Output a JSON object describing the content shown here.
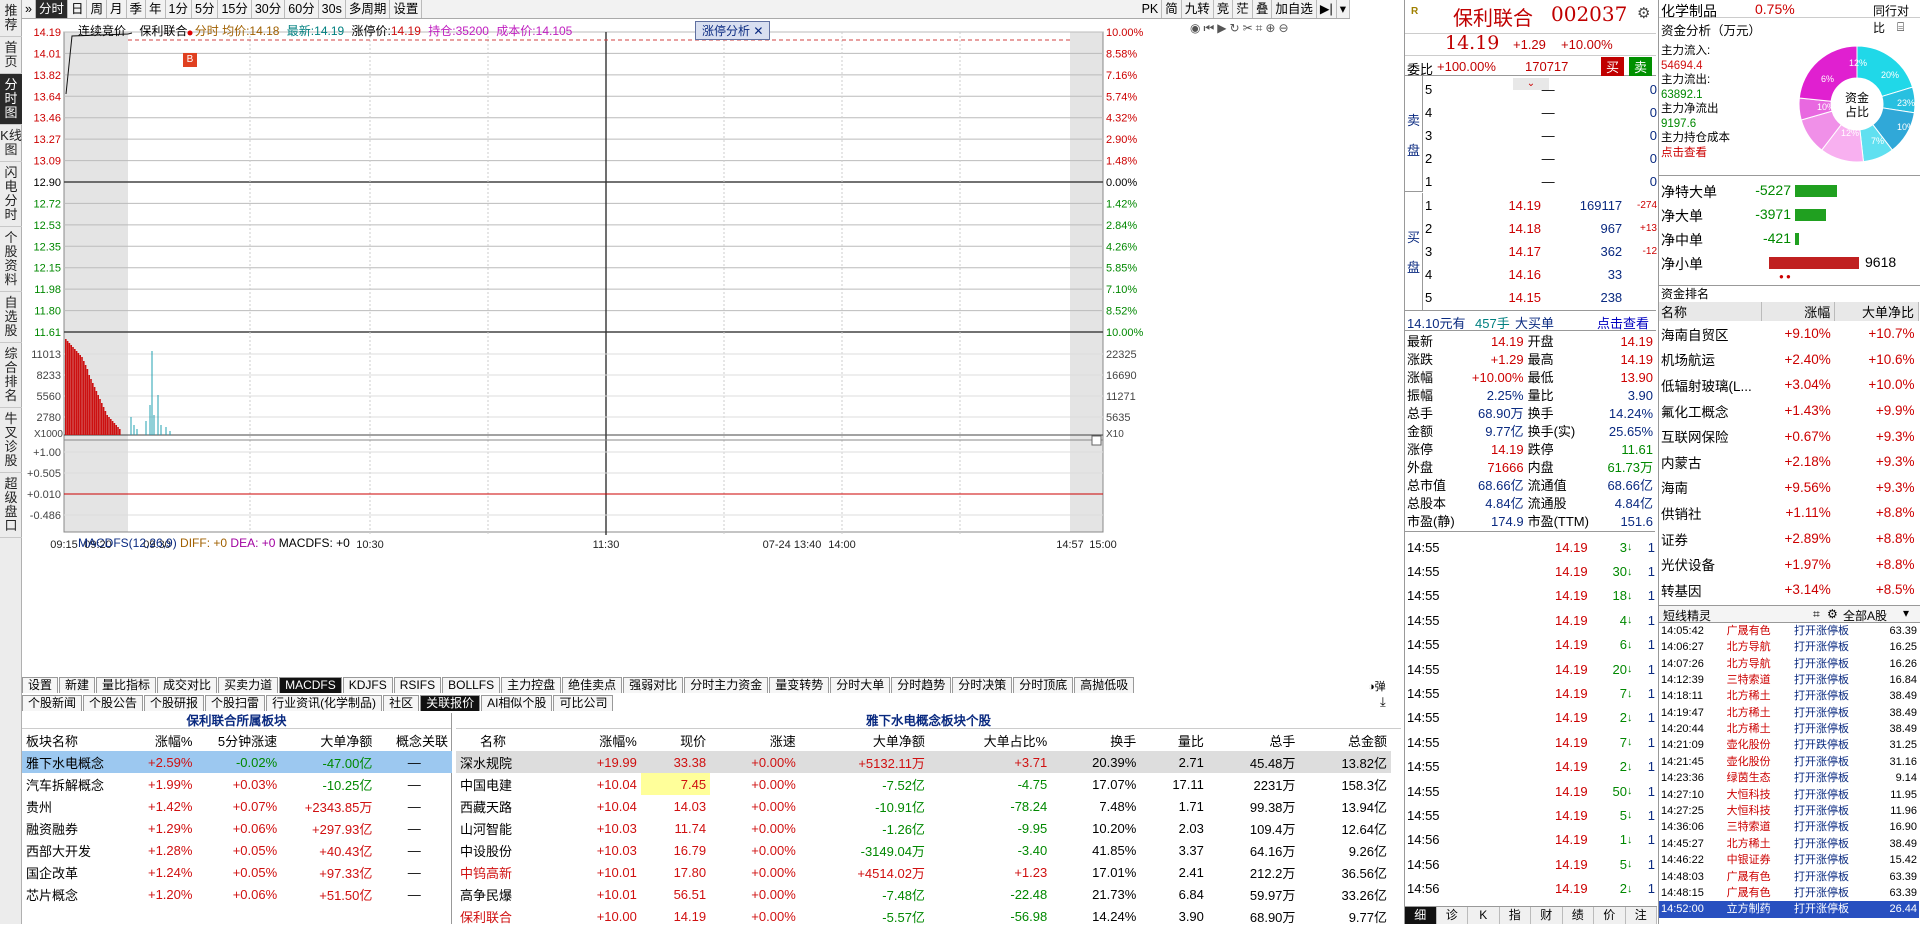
{
  "leftnav": [
    "推荐",
    "首页",
    "分时图",
    "K线图",
    "闪电分时",
    "个股资料",
    "自选股",
    "综合排名",
    "牛叉诊股",
    "超级盘口"
  ],
  "leftnav_active": 2,
  "toolbar": {
    "items": [
      "分时",
      "日",
      "周",
      "月",
      "季",
      "年",
      "1分",
      "5分",
      "15分",
      "30分",
      "60分",
      "30s",
      "多周期",
      "设置"
    ],
    "active": 0,
    "right_items": [
      "PK",
      "简",
      "九转",
      "竞",
      "茫",
      "叠",
      "加自选"
    ]
  },
  "chart_header": {
    "mode": "连续竞价",
    "name": "保利联合",
    "tick_label": "分时",
    "avg_label": "均价:",
    "avg_val": "14.18",
    "latest_label": "最新:",
    "latest_val": "14.19",
    "limit_label": "涨停价:",
    "limit_val": "14.19",
    "pos_label": "持仓:",
    "pos_val": "35200",
    "cost_label": "成本价:",
    "cost_val": "14.105",
    "zt_tab": "涨停分析",
    "b_marker": "B"
  },
  "price_axis_left": [
    "14.19",
    "14.01",
    "13.82",
    "13.64",
    "13.46",
    "13.27",
    "13.09",
    "12.90",
    "12.72",
    "12.53",
    "12.35",
    "12.15",
    "11.98",
    "11.80",
    "11.61"
  ],
  "price_axis_right": [
    "10.00%",
    "8.58%",
    "7.16%",
    "5.74%",
    "4.32%",
    "2.90%",
    "1.48%",
    "0.00%",
    "1.42%",
    "2.84%",
    "4.26%",
    "5.85%",
    "7.10%",
    "8.52%",
    "10.00%"
  ],
  "vol_axis_left": [
    "11013",
    "8233",
    "5560",
    "2780"
  ],
  "vol_axis_right": [
    "22325",
    "16690",
    "11271",
    "5635"
  ],
  "vol_unit": "X1000",
  "vol_unit_r": "X10",
  "macd_label": {
    "name": "MACDFS(12,26,9)",
    "diff": "DIFF: +0",
    "dea": "DEA: +0",
    "macdfs": "MACDFS: +0"
  },
  "macd_axis": [
    "+1.00",
    "+0.505",
    "+0.010",
    "-0.486"
  ],
  "time_axis": [
    "09:15",
    "09:20",
    "09:30",
    "10:30",
    "11:30",
    "07-24 13:40",
    "14:00",
    "14:57",
    "15:00"
  ],
  "ind_tabs": [
    "设置",
    "新建",
    "量比指标",
    "成交对比",
    "买卖力道",
    "MACDFS",
    "KDJFS",
    "RSIFS",
    "BOLLFS",
    "主力控盘",
    "绝佳卖点",
    "强弱对比",
    "分时主力资金",
    "量变转势",
    "分时大单",
    "分时趋势",
    "分时决策",
    "分时顶底",
    "高抛低吸"
  ],
  "ind_active": 5,
  "ind_right": "弹",
  "sub_tabs": [
    "个股新闻",
    "个股公告",
    "个股研报",
    "个股扫雷",
    "行业资讯(化学制品)",
    "社区",
    "关联报价",
    "AI相似个股",
    "可比公司"
  ],
  "sub_active": 6,
  "sector_table": {
    "title": "保利联合所属板块",
    "headers": [
      "板块名称",
      "涨幅%",
      "5分钟涨速",
      "大单净额",
      "概念关联"
    ],
    "rows": [
      [
        "雅下水电概念",
        "+2.59%",
        "-0.02%",
        "-47.00亿",
        "—"
      ],
      [
        "汽车拆解概念",
        "+1.99%",
        "+0.03%",
        "-10.25亿",
        "—"
      ],
      [
        "贵州",
        "+1.42%",
        "+0.07%",
        "+2343.85万",
        "—"
      ],
      [
        "融资融券",
        "+1.29%",
        "+0.06%",
        "+297.93亿",
        "—"
      ],
      [
        "西部大开发",
        "+1.28%",
        "+0.05%",
        "+40.43亿",
        "—"
      ],
      [
        "国企改革",
        "+1.24%",
        "+0.05%",
        "+97.33亿",
        "—"
      ],
      [
        "芯片概念",
        "+1.20%",
        "+0.06%",
        "+51.50亿",
        "—"
      ]
    ]
  },
  "stock_table": {
    "title": "雅下水电概念板块个股",
    "headers": [
      "名称",
      "涨幅%",
      "现价",
      "涨速",
      "大单净额",
      "大单占比%",
      "换手",
      "量比",
      "总手",
      "总金额"
    ],
    "rows": [
      [
        "深水规院",
        "+19.99",
        "33.38",
        "+0.00%",
        "+5132.11万",
        "+3.71",
        "20.39%",
        "2.71",
        "45.48万",
        "13.82亿"
      ],
      [
        "中国电建",
        "+10.04",
        "7.45",
        "+0.00%",
        "-7.52亿",
        "-4.75",
        "17.07%",
        "17.11",
        "2231万",
        "158.3亿"
      ],
      [
        "西藏天路",
        "+10.04",
        "14.03",
        "+0.00%",
        "-10.91亿",
        "-78.24",
        "7.48%",
        "1.71",
        "99.38万",
        "13.94亿"
      ],
      [
        "山河智能",
        "+10.03",
        "11.74",
        "+0.00%",
        "-1.26亿",
        "-9.95",
        "10.20%",
        "2.03",
        "109.4万",
        "12.64亿"
      ],
      [
        "中设股份",
        "+10.03",
        "16.79",
        "+0.00%",
        "-3149.04万",
        "-3.40",
        "41.85%",
        "3.37",
        "64.16万",
        "9.26亿"
      ],
      [
        "中钨高新",
        "+10.01",
        "17.80",
        "+0.00%",
        "+4514.02万",
        "+1.23",
        "17.01%",
        "2.41",
        "212.2万",
        "36.56亿"
      ],
      [
        "高争民爆",
        "+10.01",
        "56.51",
        "+0.00%",
        "-7.48亿",
        "-22.48",
        "21.73%",
        "6.84",
        "59.97万",
        "33.26亿"
      ],
      [
        "保利联合",
        "+10.00",
        "14.19",
        "+0.00%",
        "-5.57亿",
        "-56.98",
        "14.24%",
        "3.90",
        "68.90万",
        "9.77亿"
      ]
    ]
  },
  "stock": {
    "badge": "R",
    "name": "保利联合",
    "code": "002037",
    "price": "14.19",
    "chg": "+1.29",
    "pct": "+10.00%",
    "ratio_label": "委比",
    "ratio": "+100.00%",
    "ratio_diff": "170717",
    "buy": "买",
    "sell": "卖"
  },
  "orderbook": {
    "sell_label": [
      "卖",
      "盘"
    ],
    "buy_label": [
      "买",
      "盘"
    ],
    "sell": [
      [
        "5",
        "—",
        "0"
      ],
      [
        "4",
        "—",
        "0"
      ],
      [
        "3",
        "—",
        "0"
      ],
      [
        "2",
        "—",
        "0"
      ],
      [
        "1",
        "—",
        "0"
      ]
    ],
    "buy": [
      [
        "1",
        "14.19",
        "169117",
        "-274"
      ],
      [
        "2",
        "14.18",
        "967",
        "+13"
      ],
      [
        "3",
        "14.17",
        "362",
        "-12"
      ],
      [
        "4",
        "14.16",
        "33",
        ""
      ],
      [
        "5",
        "14.15",
        "238",
        ""
      ]
    ]
  },
  "bigorder": {
    "price": "14.10元有",
    "vol": "457手",
    "kind": "大买单",
    "link": "点击查看"
  },
  "quote": [
    [
      "最新",
      "14.19",
      "开盘",
      "14.19"
    ],
    [
      "涨跌",
      "+1.29",
      "最高",
      "14.19"
    ],
    [
      "涨幅",
      "+10.00%",
      "最低",
      "13.90"
    ],
    [
      "振幅",
      "2.25%",
      "量比",
      "3.90"
    ],
    [
      "总手",
      "68.90万",
      "换手",
      "14.24%"
    ],
    [
      "金额",
      "9.77亿",
      "换手(实)",
      "25.65%"
    ],
    [
      "涨停",
      "14.19",
      "跌停",
      "11.61"
    ],
    [
      "外盘",
      "71666",
      "内盘",
      "61.73万"
    ],
    [
      "总市值",
      "68.66亿",
      "流通值",
      "68.66亿"
    ],
    [
      "总股本",
      "4.84亿",
      "流通股",
      "4.84亿"
    ],
    [
      "市盈(静)",
      "174.9",
      "市盈(TTM)",
      "151.6"
    ]
  ],
  "ticks": [
    [
      "14:55",
      "14.19",
      "3"
    ],
    [
      "14:55",
      "14.19",
      "30"
    ],
    [
      "14:55",
      "14.19",
      "18"
    ],
    [
      "14:55",
      "14.19",
      "4"
    ],
    [
      "14:55",
      "14.19",
      "6"
    ],
    [
      "14:55",
      "14.19",
      "20"
    ],
    [
      "14:55",
      "14.19",
      "7"
    ],
    [
      "14:55",
      "14.19",
      "2"
    ],
    [
      "14:55",
      "14.19",
      "7"
    ],
    [
      "14:55",
      "14.19",
      "2"
    ],
    [
      "14:55",
      "14.19",
      "50"
    ],
    [
      "14:55",
      "14.19",
      "5"
    ],
    [
      "14:56",
      "14.19",
      "1"
    ],
    [
      "14:56",
      "14.19",
      "5"
    ],
    [
      "14:56",
      "14.19",
      "2"
    ]
  ],
  "tick_counts": [
    "1",
    "1",
    "1",
    "1",
    "1",
    "1",
    "1",
    "1",
    "1",
    "1",
    "1",
    "1",
    "1",
    "1",
    "1"
  ],
  "bottom_tabs": [
    "细",
    "诊",
    "K",
    "指",
    "财",
    "绩",
    "价",
    "注"
  ],
  "industry": {
    "name": "化学制品",
    "pct": "0.75%",
    "link": "同行对比"
  },
  "capital": {
    "title": "资金分析（万元）",
    "inflow_label": "主力流入:",
    "inflow": "54694.4",
    "outflow_label": "主力流出:",
    "outflow": "63892.1",
    "net_label": "主力净流出",
    "net": "9197.6",
    "cost_label": "主力持仓成本",
    "cost_link": "点击查看",
    "pie_center": [
      "资金",
      "占比"
    ],
    "pie_labels": [
      "20%",
      "23%",
      "10%",
      "7%",
      "12%",
      "10%",
      "6%",
      "12%"
    ]
  },
  "netflows": [
    {
      "label": "净特大单",
      "value": "-5227",
      "frac": 0.54
    },
    {
      "label": "净大单",
      "value": "-3971",
      "frac": 0.41
    },
    {
      "label": "净中单",
      "value": "-421",
      "frac": 0.05
    },
    {
      "label": "净小单",
      "value": "9618",
      "frac": 1.0
    }
  ],
  "rank": {
    "title": "资金排名",
    "headers": [
      "名称",
      "涨幅",
      "大单净比"
    ],
    "rows": [
      [
        "海南自贸区",
        "+9.10%",
        "+10.7%"
      ],
      [
        "机场航运",
        "+2.40%",
        "+10.6%"
      ],
      [
        "低辐射玻璃(L...",
        "+3.04%",
        "+10.0%"
      ],
      [
        "氟化工概念",
        "+1.43%",
        "+9.9%"
      ],
      [
        "互联网保险",
        "+0.67%",
        "+9.3%"
      ],
      [
        "内蒙古",
        "+2.18%",
        "+9.3%"
      ],
      [
        "海南",
        "+9.56%",
        "+9.3%"
      ],
      [
        "供销社",
        "+1.11%",
        "+8.8%"
      ],
      [
        "证券",
        "+2.89%",
        "+8.8%"
      ],
      [
        "光伏设备",
        "+1.97%",
        "+8.8%"
      ],
      [
        "转基因",
        "+3.14%",
        "+8.5%"
      ]
    ]
  },
  "shortline": {
    "title": "短线精灵",
    "filter": "全部A股",
    "rows": [
      [
        "14:05:42",
        "广晟有色",
        "打开涨停板",
        "63.39"
      ],
      [
        "14:06:27",
        "北方导航",
        "打开涨停板",
        "16.25"
      ],
      [
        "14:07:26",
        "北方导航",
        "打开涨停板",
        "16.26"
      ],
      [
        "14:12:39",
        "三特索道",
        "打开涨停板",
        "16.84"
      ],
      [
        "14:18:11",
        "北方稀土",
        "打开涨停板",
        "38.49"
      ],
      [
        "14:19:47",
        "北方稀土",
        "打开涨停板",
        "38.49"
      ],
      [
        "14:20:44",
        "北方稀土",
        "打开涨停板",
        "38.49"
      ],
      [
        "14:21:09",
        "壶化股份",
        "打开跌停板",
        "31.25"
      ],
      [
        "14:21:45",
        "壶化股份",
        "打开涨停板",
        "31.16"
      ],
      [
        "14:23:36",
        "绿茵生态",
        "打开涨停板",
        "9.14"
      ],
      [
        "14:27:10",
        "大恒科技",
        "打开涨停板",
        "11.95"
      ],
      [
        "14:27:25",
        "大恒科技",
        "打开涨停板",
        "11.96"
      ],
      [
        "14:36:06",
        "三特索道",
        "打开涨停板",
        "16.90"
      ],
      [
        "14:45:27",
        "北方稀土",
        "打开涨停板",
        "38.49"
      ],
      [
        "14:46:22",
        "中银证券",
        "打开涨停板",
        "15.42"
      ],
      [
        "14:48:03",
        "广晟有色",
        "打开涨停板",
        "63.39"
      ],
      [
        "14:48:15",
        "广晟有色",
        "打开涨停板",
        "63.39"
      ],
      [
        "14:52:00",
        "立方制药",
        "打开涨停板",
        "26.44"
      ]
    ]
  },
  "colors": {
    "up": "#d01010",
    "down": "#008800",
    "accent": "#0a2a80"
  }
}
